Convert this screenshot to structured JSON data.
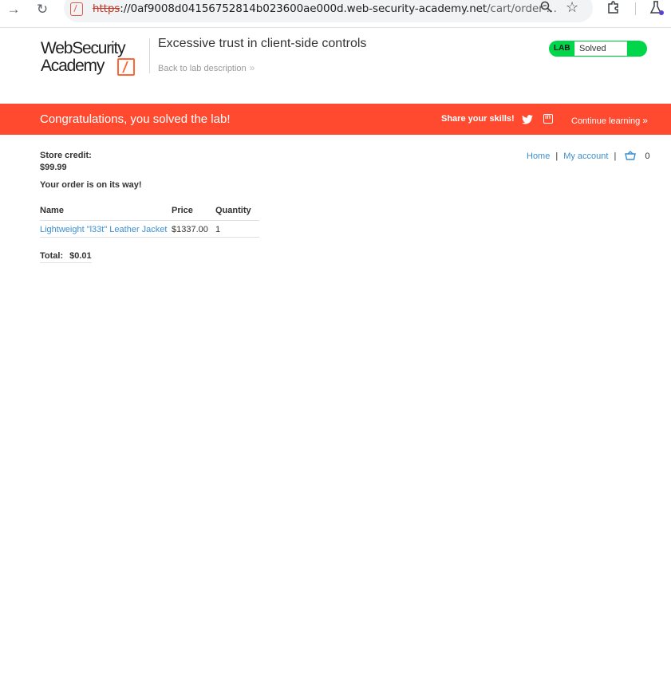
{
  "browser": {
    "url_protocol": "https",
    "url_sep": "://",
    "url_host": "0af9008d04156752814b023600ae000d.web-security-academy.net",
    "url_path": "/cart/order-…"
  },
  "header": {
    "logo_line1": "WebSecurity",
    "logo_line2": "Academy",
    "lab_title": "Excessive trust in client-side controls",
    "back_link": "Back to lab description",
    "lab_tag": "LAB",
    "lab_status": "Solved",
    "status_color": "#00d64a"
  },
  "banner": {
    "message": "Congratulations, you solved the lab!",
    "share_label": "Share your skills!",
    "continue_label": "Continue learning",
    "color": "#ff4a2f"
  },
  "store": {
    "credit_label": "Store credit:",
    "credit_value": "$99.99",
    "nav_home": "Home",
    "nav_account": "My account",
    "cart_count": "0",
    "order_message": "Your order is on its way!",
    "table": {
      "headers": [
        "Name",
        "Price",
        "Quantity"
      ],
      "rows": [
        {
          "name": "Lightweight \"l33t\" Leather Jacket",
          "price": "$1337.00",
          "quantity": "1"
        }
      ]
    },
    "total_label": "Total:",
    "total_value": "$0.01"
  }
}
